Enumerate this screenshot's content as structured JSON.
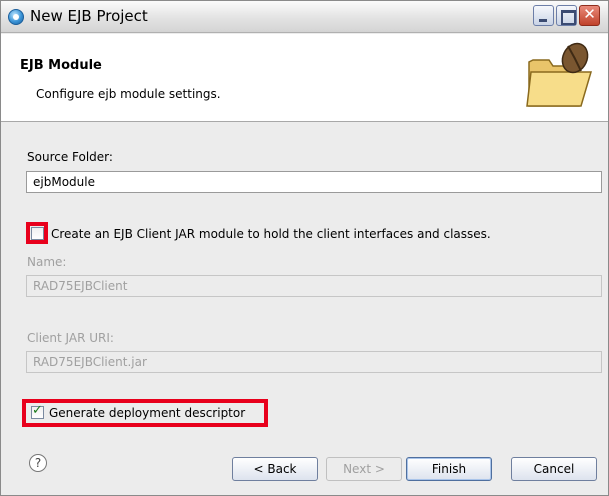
{
  "window": {
    "title": "New EJB Project"
  },
  "banner": {
    "title": "EJB Module",
    "description": "Configure ejb module settings."
  },
  "form": {
    "source_folder_label": "Source Folder:",
    "source_folder_value": "ejbModule",
    "create_client_label": "Create an EJB Client JAR module to hold the client interfaces and classes.",
    "create_client_checked": false,
    "name_label": "Name:",
    "name_value": "RAD75EJBClient",
    "client_jar_uri_label": "Client JAR URI:",
    "client_jar_uri_value": "RAD75EJBClient.jar",
    "generate_dd_label": "Generate deployment descriptor",
    "generate_dd_checked": true
  },
  "footer": {
    "help_glyph": "?",
    "back_label": "< Back",
    "next_label": "Next >",
    "finish_label": "Finish",
    "cancel_label": "Cancel"
  },
  "colors": {
    "highlight": "#e8001c",
    "dialog_background": "#ececec"
  }
}
